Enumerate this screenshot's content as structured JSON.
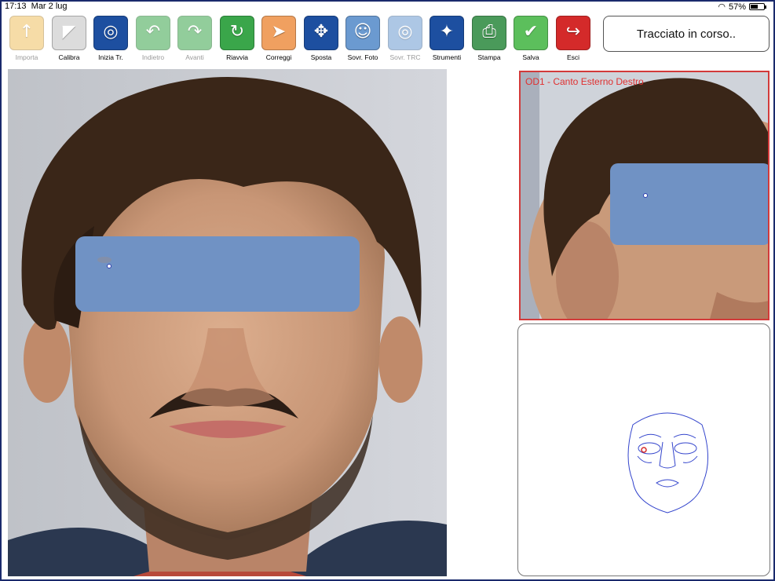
{
  "status": {
    "time": "17:13",
    "date": "Mar 2 lug",
    "battery": "57%",
    "battery_level": 0.57
  },
  "toolbar": {
    "items": [
      {
        "label": "Importa",
        "icon": "import-folder-icon",
        "enabled": false,
        "color": "#f0c060"
      },
      {
        "label": "Calibra",
        "icon": "calibrate-ruler-icon",
        "enabled": true,
        "color": "#dcdcdc"
      },
      {
        "label": "Inizia Tr.",
        "icon": "start-tracing-icon",
        "enabled": true,
        "color": "#1d4fa0"
      },
      {
        "label": "Indietro",
        "icon": "undo-arrow-icon",
        "enabled": false,
        "color": "#3aa64a"
      },
      {
        "label": "Avanti",
        "icon": "redo-arrow-icon",
        "enabled": false,
        "color": "#3aa64a"
      },
      {
        "label": "Riavvia",
        "icon": "restart-icon",
        "enabled": true,
        "color": "#3aa64a"
      },
      {
        "label": "Correggi",
        "icon": "correct-point-icon",
        "enabled": true,
        "color": "#f0a060"
      },
      {
        "label": "Sposta",
        "icon": "move-arrows-icon",
        "enabled": true,
        "color": "#1d4fa0"
      },
      {
        "label": "Sovr. Foto",
        "icon": "overlay-photo-icon",
        "enabled": true,
        "color": "#6b9ad0"
      },
      {
        "label": "Sovr. TRC",
        "icon": "overlay-tracing-icon",
        "enabled": false,
        "color": "#6b9ad0"
      },
      {
        "label": "Strumenti",
        "icon": "magic-wand-icon",
        "enabled": true,
        "color": "#1d4fa0"
      },
      {
        "label": "Stampa",
        "icon": "printer-icon",
        "enabled": true,
        "color": "#4a9a5a"
      },
      {
        "label": "Salva",
        "icon": "save-check-icon",
        "enabled": true,
        "color": "#5cbf5c"
      },
      {
        "label": "Esci",
        "icon": "exit-door-icon",
        "enabled": true,
        "color": "#d42a2a"
      }
    ]
  },
  "status_button": {
    "label": "Tracciato in corso.."
  },
  "zoom_panel": {
    "title": "OD1 - Canto Esterno Destro"
  },
  "colors": {
    "frame": "#1a2a6c",
    "eye_mask": "#7092c4",
    "zoom_border": "#d23a3a",
    "schema_lines": "#3344cc",
    "marker": "#d42a2a"
  }
}
